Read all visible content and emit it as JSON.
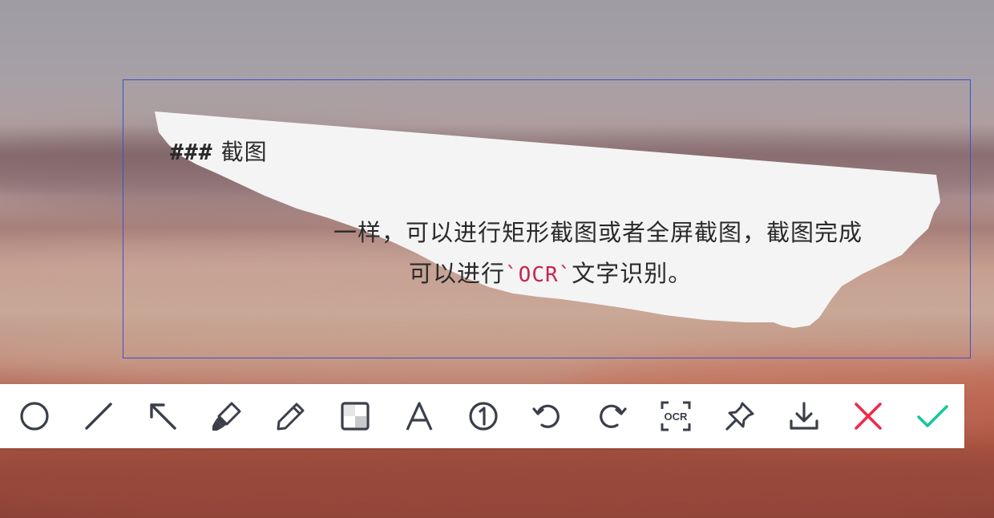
{
  "document": {
    "heading_hashes": "###",
    "heading_title": "截图",
    "line1": "一样，可以进行矩形截图或者全屏截图，截图完成",
    "line2_before": "可以进行",
    "line2_code": "`OCR`",
    "line2_after": "文字识别。"
  },
  "toolbar": {
    "tools": [
      {
        "name": "ellipse",
        "icon": "circle-icon"
      },
      {
        "name": "line",
        "icon": "line-icon"
      },
      {
        "name": "arrow",
        "icon": "arrow-icon"
      },
      {
        "name": "highlighter",
        "icon": "highlighter-icon"
      },
      {
        "name": "pencil",
        "icon": "pencil-icon"
      },
      {
        "name": "mosaic",
        "icon": "mosaic-icon"
      },
      {
        "name": "text",
        "icon": "text-icon"
      },
      {
        "name": "serial-number",
        "icon": "number-circle-icon"
      },
      {
        "name": "undo",
        "icon": "undo-icon"
      },
      {
        "name": "redo",
        "icon": "redo-icon"
      },
      {
        "name": "ocr",
        "icon": "ocr-icon"
      },
      {
        "name": "pin",
        "icon": "pin-icon"
      },
      {
        "name": "save",
        "icon": "download-icon"
      },
      {
        "name": "cancel",
        "icon": "close-icon"
      },
      {
        "name": "confirm",
        "icon": "check-icon"
      }
    ],
    "ocr_label": "OCR",
    "number_label": "1"
  },
  "colors": {
    "icon": "#3b3f4a",
    "cancel": "#f0294a",
    "confirm": "#16c79a",
    "selection_border": "#3d4fd6",
    "code": "#c7254e",
    "paper": "#f4f4f4"
  }
}
